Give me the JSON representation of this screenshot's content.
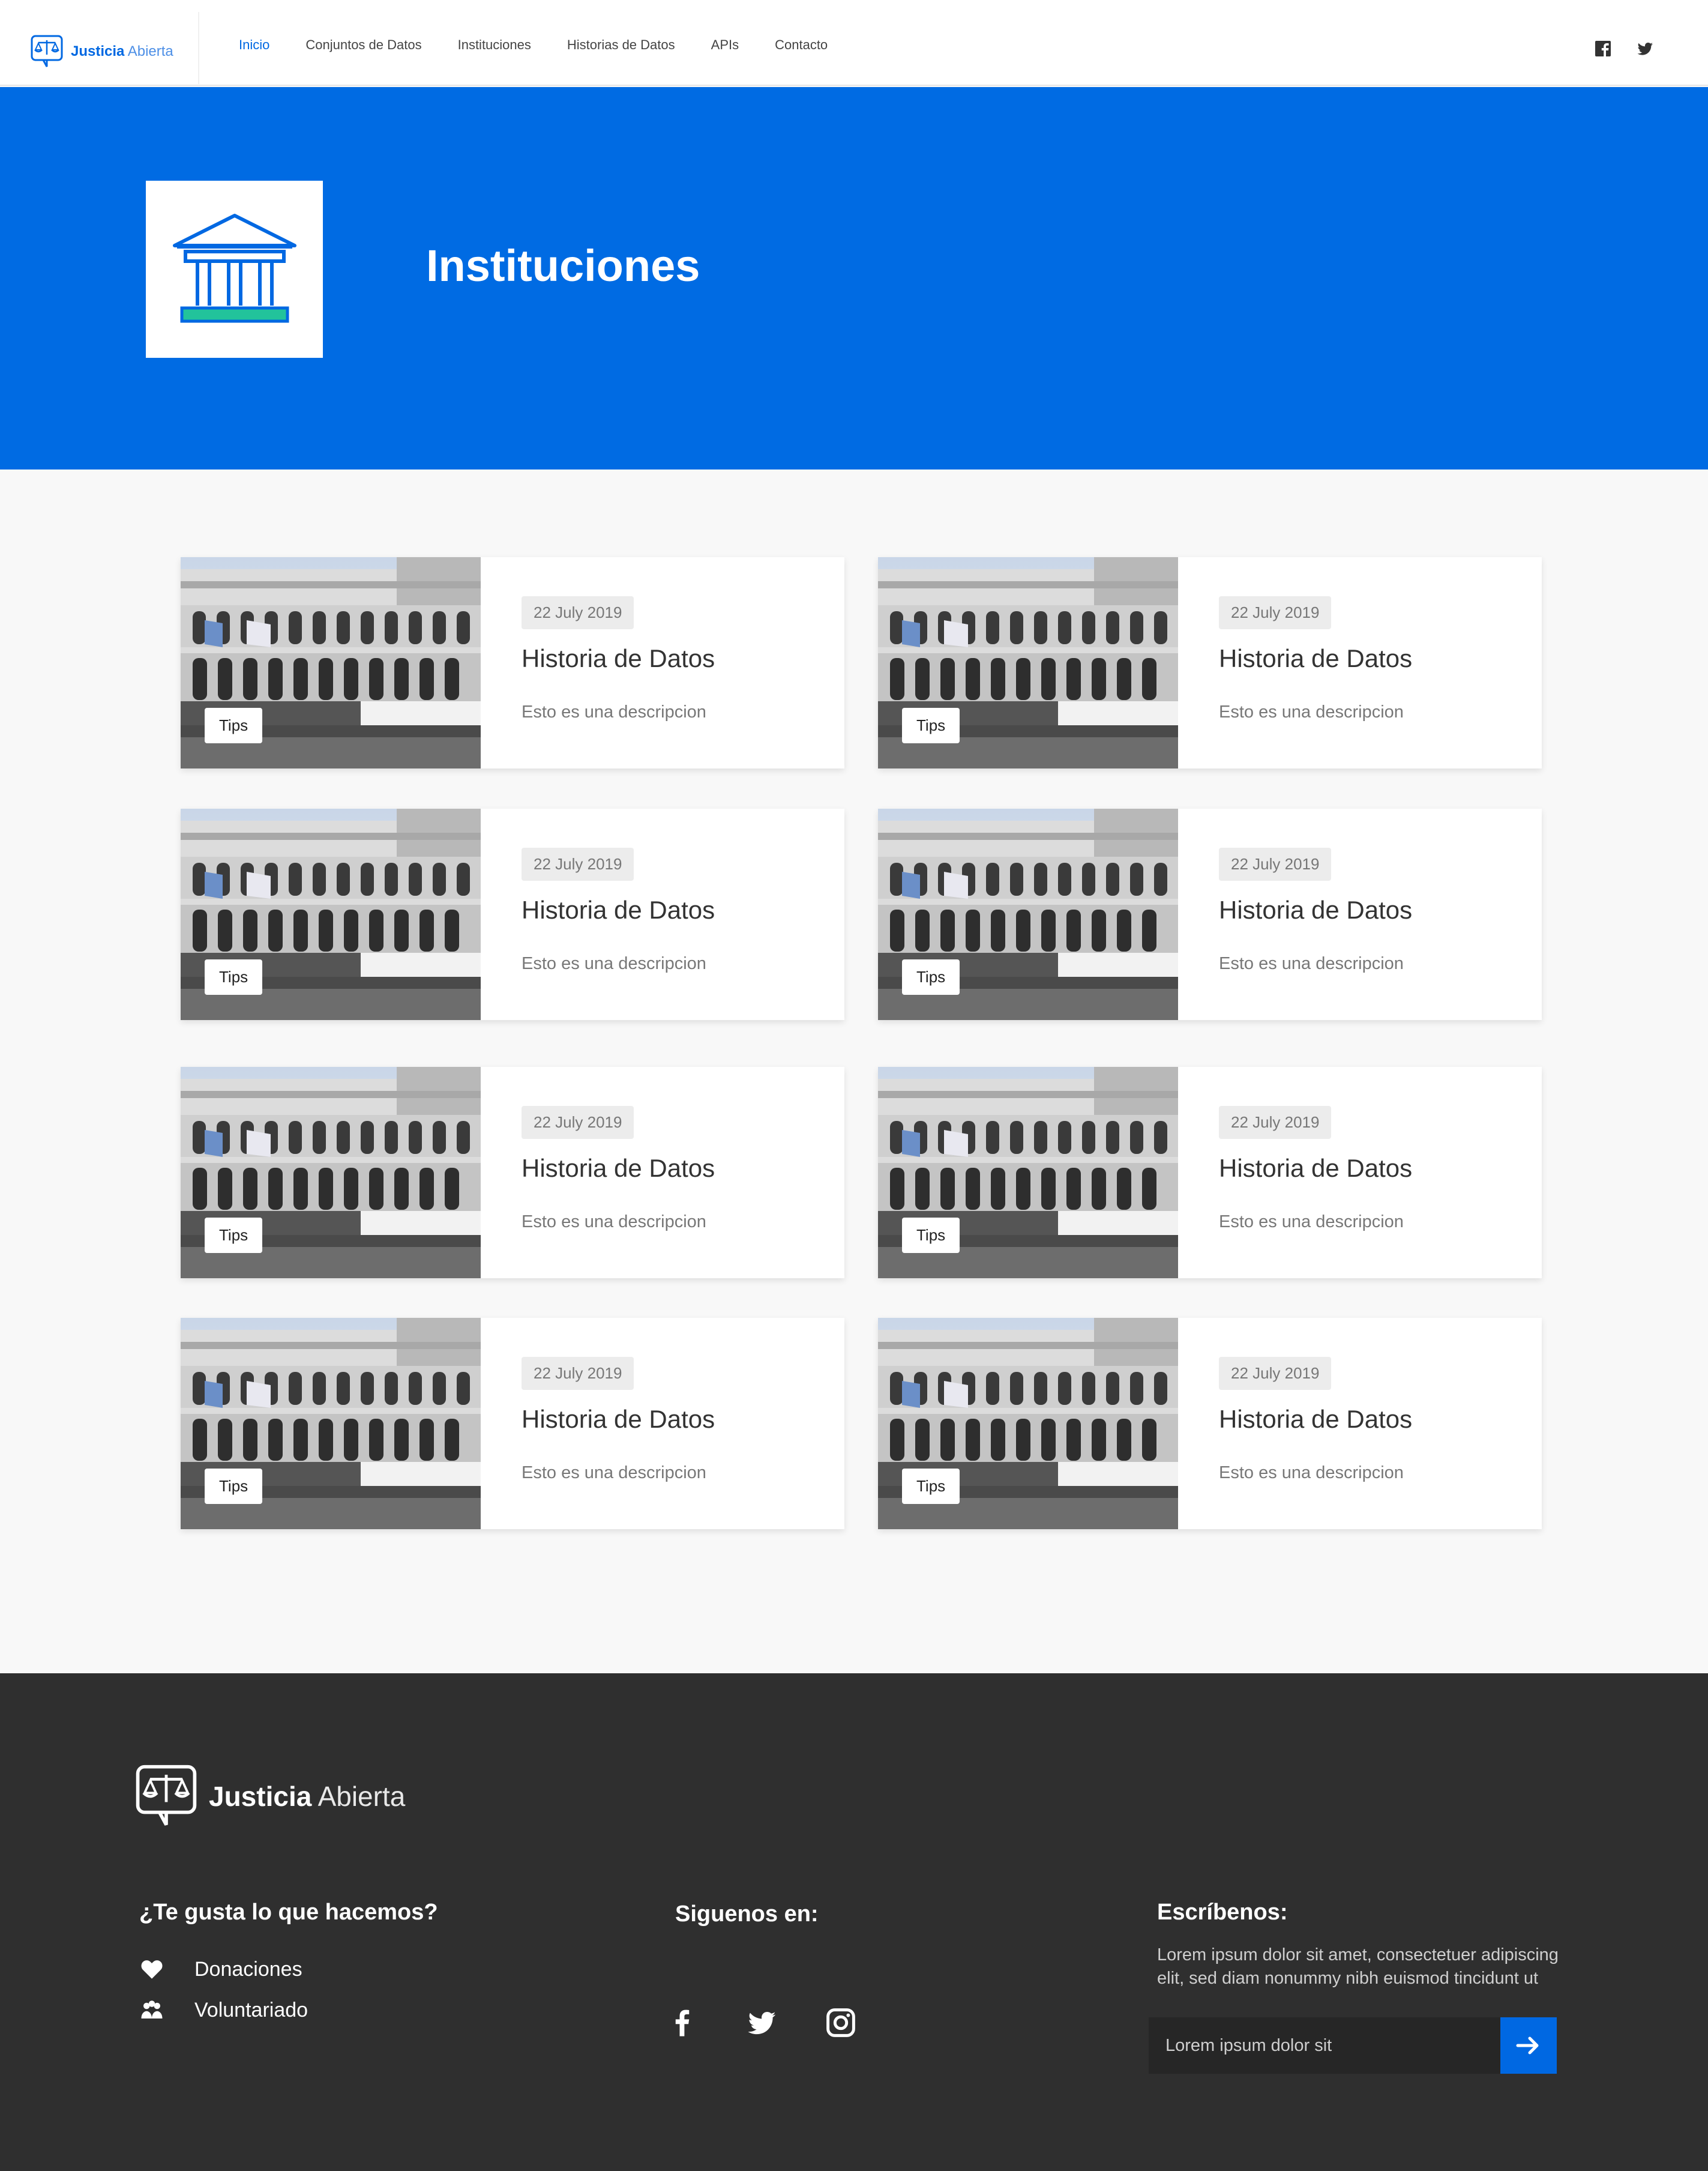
{
  "brand": {
    "bold": "Justicia",
    "light": "Abierta"
  },
  "nav": {
    "items": [
      {
        "label": "Inicio",
        "active": true
      },
      {
        "label": "Conjuntos de Datos",
        "active": false
      },
      {
        "label": "Instituciones",
        "active": false
      },
      {
        "label": "Historias de Datos",
        "active": false
      },
      {
        "label": "APIs",
        "active": false
      },
      {
        "label": "Contacto",
        "active": false
      }
    ],
    "social": [
      "facebook-icon",
      "twitter-icon"
    ]
  },
  "hero": {
    "title": "Instituciones",
    "icon": "institution-icon"
  },
  "cards": [
    {
      "tag": "Tips",
      "date": "22 July 2019",
      "title": "Historia de Datos",
      "description": "Esto es una descripcion"
    },
    {
      "tag": "Tips",
      "date": "22 July 2019",
      "title": "Historia de Datos",
      "description": "Esto es una descripcion"
    },
    {
      "tag": "Tips",
      "date": "22 July 2019",
      "title": "Historia de Datos",
      "description": "Esto es una descripcion"
    },
    {
      "tag": "Tips",
      "date": "22 July 2019",
      "title": "Historia de Datos",
      "description": "Esto es una descripcion"
    },
    {
      "tag": "Tips",
      "date": "22 July 2019",
      "title": "Historia de Datos",
      "description": "Esto es una descripcion"
    },
    {
      "tag": "Tips",
      "date": "22 July 2019",
      "title": "Historia de Datos",
      "description": "Esto es una descripcion"
    },
    {
      "tag": "Tips",
      "date": "22 July 2019",
      "title": "Historia de Datos",
      "description": "Esto es una descripcion"
    },
    {
      "tag": "Tips",
      "date": "22 July 2019",
      "title": "Historia de Datos",
      "description": "Esto es una descripcion"
    }
  ],
  "footer": {
    "brand_bold": "Justicia",
    "brand_light": "Abierta",
    "col1": {
      "heading": "¿Te gusta lo que hacemos?",
      "donations": "Donaciones",
      "volunteer": "Voluntariado"
    },
    "col2": {
      "heading": "Siguenos en:",
      "social": [
        "facebook-icon",
        "twitter-icon",
        "instagram-icon"
      ]
    },
    "col3": {
      "heading": "Escríbenos:",
      "text": "Lorem ipsum dolor sit amet, consectetuer adipiscing elit, sed diam nonummy nibh euismod tincidunt ut",
      "input_placeholder": "Lorem ipsum dolor sit"
    }
  },
  "colors": {
    "primary": "#006be3",
    "footer_bg": "#2f2f2f",
    "accent_green": "#22c39b"
  }
}
